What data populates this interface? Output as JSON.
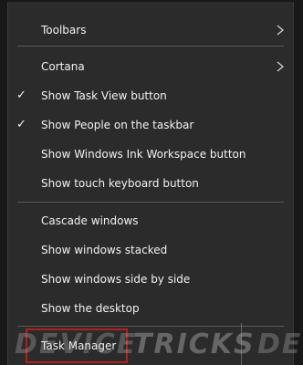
{
  "menu": {
    "items": [
      {
        "label": "Toolbars",
        "checked": false,
        "submenu": true
      },
      {
        "label": "Cortana",
        "checked": false,
        "submenu": true
      },
      {
        "label": "Show Task View button",
        "checked": true,
        "submenu": false
      },
      {
        "label": "Show People on the taskbar",
        "checked": true,
        "submenu": false
      },
      {
        "label": "Show Windows Ink Workspace button",
        "checked": false,
        "submenu": false
      },
      {
        "label": "Show touch keyboard button",
        "checked": false,
        "submenu": false
      },
      {
        "label": "Cascade windows",
        "checked": false,
        "submenu": false
      },
      {
        "label": "Show windows stacked",
        "checked": false,
        "submenu": false
      },
      {
        "label": "Show windows side by side",
        "checked": false,
        "submenu": false
      },
      {
        "label": "Show the desktop",
        "checked": false,
        "submenu": false
      },
      {
        "label": "Task Manager",
        "checked": false,
        "submenu": false
      }
    ],
    "check_glyph": "✓",
    "chevron_icon": "chevron-right-icon"
  },
  "watermark": {
    "part1": "DEVICE",
    "part2": "TRICKS",
    "part3": "DEV"
  },
  "colors": {
    "menu_background": "#2b2b2b",
    "text": "#f2f2f2",
    "separator": "#5a5a5a",
    "highlight_border": "#b2201e"
  }
}
